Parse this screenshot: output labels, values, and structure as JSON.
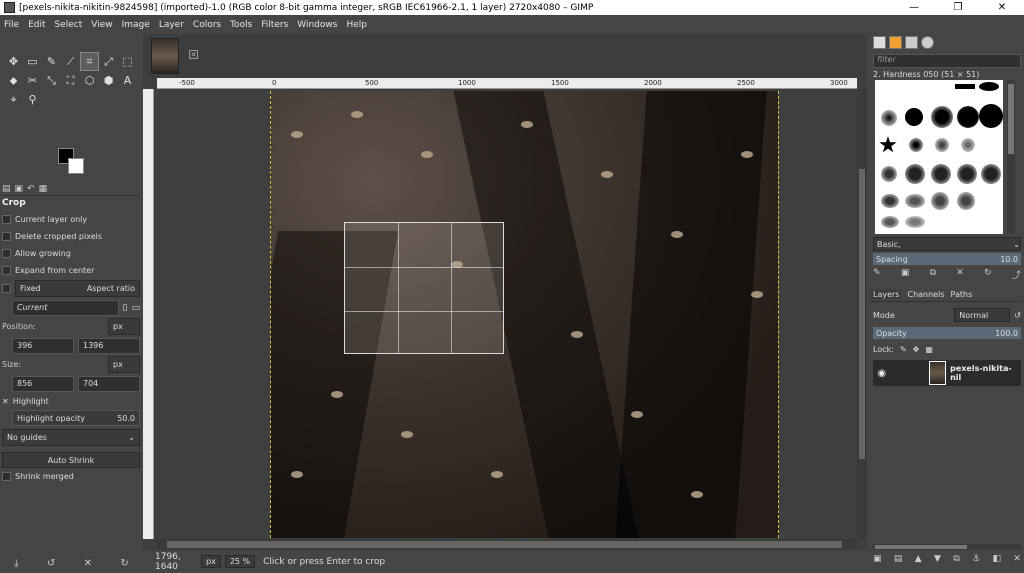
{
  "window": {
    "title": "[pexels-nikita-nikitin-9824598] (imported)-1.0 (RGB color 8-bit gamma integer, sRGB IEC61966-2.1, 1 layer) 2720x4080 – GIMP",
    "minimize": "—",
    "maximize": "❐",
    "close": "✕"
  },
  "menu": [
    "File",
    "Edit",
    "Select",
    "View",
    "Image",
    "Layer",
    "Colors",
    "Tools",
    "Filters",
    "Windows",
    "Help"
  ],
  "tools": [
    "✥",
    "▭",
    "✎",
    "⟋",
    "⌗",
    "⤢",
    "⬚",
    "⬥",
    "✂",
    "⤡",
    "⛶",
    "⬡",
    "⬢",
    "A",
    "◆",
    "╱",
    "⌫",
    "⚗",
    "⚙",
    "◉",
    "◌",
    "⌖",
    "⚲"
  ],
  "tool_options": {
    "title": "Crop",
    "current_layer_only": "Current layer only",
    "delete_cropped": "Delete cropped pixels",
    "allow_growing": "Allow growing",
    "expand_center": "Expand from center",
    "fixed": "Fixed",
    "aspect_ratio": "Aspect ratio",
    "current_value": "Current",
    "position_label": "Position:",
    "position_unit": "px",
    "pos_x": "396",
    "pos_y": "1396",
    "size_label": "Size:",
    "size_unit": "px",
    "size_w": "856",
    "size_h": "704",
    "highlight": "Highlight",
    "highlight_opacity_label": "Highlight opacity",
    "highlight_opacity_value": "50.0",
    "guides": "No guides",
    "auto_shrink": "Auto Shrink",
    "shrink_merged": "Shrink merged"
  },
  "ruler": {
    "labels": [
      "-500",
      "0",
      "500",
      "1000",
      "1500",
      "2000",
      "2500",
      "3000"
    ]
  },
  "status": {
    "coords": "1796, 1640",
    "unit": "px",
    "zoom": "25 %",
    "message": "Click or press Enter to crop"
  },
  "brushes": {
    "filter_placeholder": "filter",
    "selected": "2. Hardness 050 (51 × 51)",
    "preset": "Basic,",
    "spacing_label": "Spacing",
    "spacing_value": "10.0"
  },
  "layers": {
    "tab_layers": "Layers",
    "tab_channels": "Channels",
    "tab_paths": "Paths",
    "mode_label": "Mode",
    "mode_value": "Normal",
    "opacity_label": "Opacity",
    "opacity_value": "100.0",
    "lock_label": "Lock:",
    "layer_name": "pexels-nikita-nil"
  },
  "colors": {
    "fg": "#000000",
    "bg": "#ffffff",
    "accent": "#5a6a78",
    "guide": "#d4c13a"
  }
}
